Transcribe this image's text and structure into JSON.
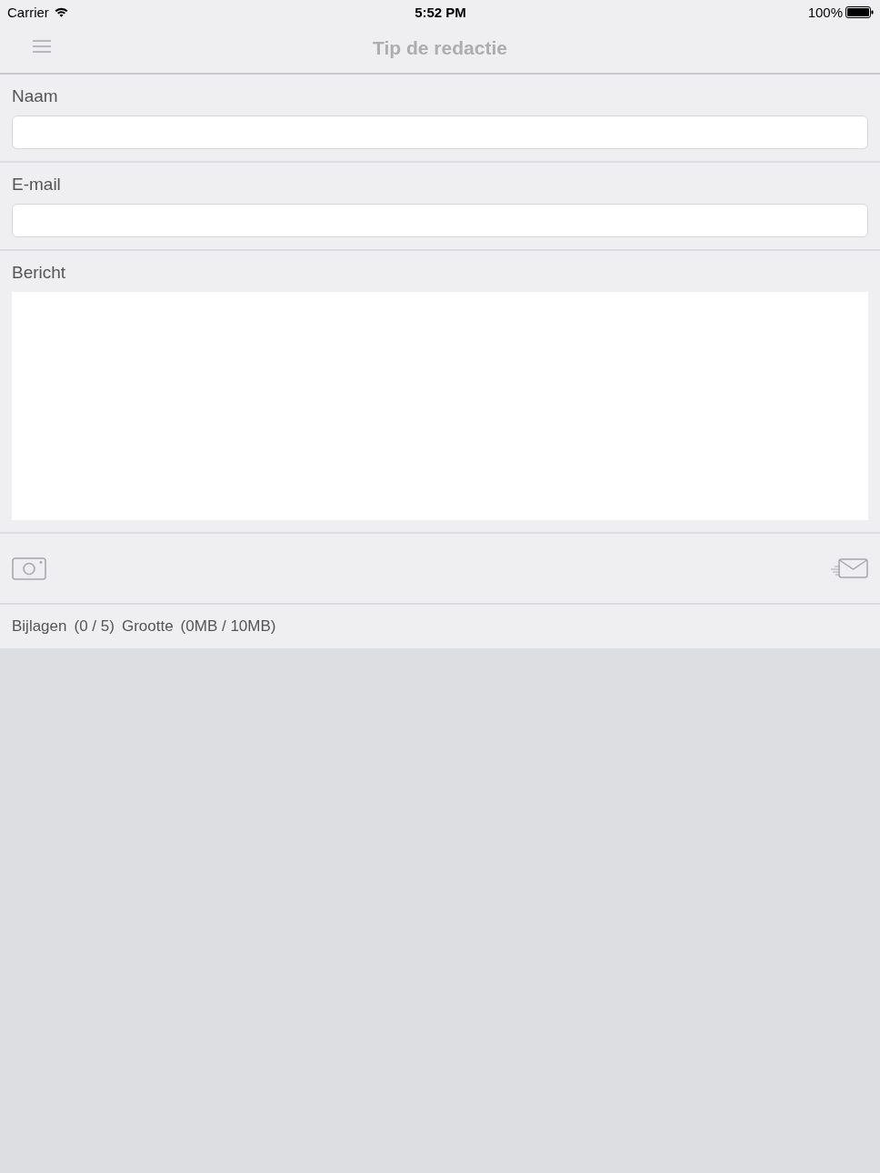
{
  "status_bar": {
    "carrier": "Carrier",
    "time": "5:52 PM",
    "battery": "100%"
  },
  "nav_bar": {
    "title": "Tip de redactie"
  },
  "form": {
    "fields": [
      {
        "kind": "text",
        "label": "Naam"
      },
      {
        "kind": "text",
        "label": "E-mail"
      },
      {
        "kind": "textarea",
        "label": "Bericht"
      }
    ]
  },
  "footer": {
    "attachments_label": "Bijlagen",
    "attachments_count": "(0 / 5)",
    "size_label": "Grootte",
    "size_value": "(0MB / 10MB)"
  }
}
